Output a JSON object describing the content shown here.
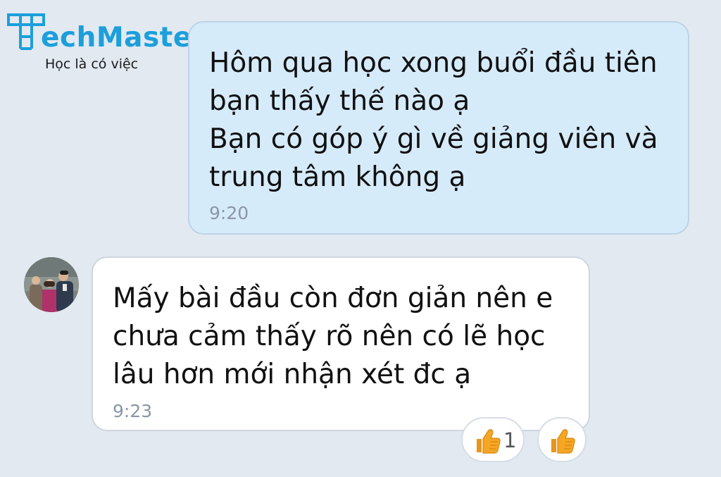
{
  "logo": {
    "wordmark": "TechMaster",
    "wordmark_rest": "echMaster",
    "tagline": "Học là có việc",
    "color": "#1c9fdb"
  },
  "messages": [
    {
      "direction": "outgoing",
      "text": "Hôm qua học xong buổi đầu tiên\nbạn thấy thế nào ạ\nBạn có góp ý gì về giảng viên và\ntrung tâm không ạ",
      "time": "9:20",
      "bg": "#d6ebfa"
    },
    {
      "direction": "incoming",
      "text": "Mấy bài đầu còn đơn giản nên e\nchưa cảm thấy rõ nên có lẽ học\nlâu hơn mới nhận xét đc ạ",
      "time": "9:23",
      "bg": "#ffffff",
      "avatar_icon": "user-photo-avatar"
    }
  ],
  "reactions": {
    "thumbs_up": {
      "icon": "thumbs-up-icon",
      "count": "1"
    },
    "add": {
      "icon": "thumbs-up-icon"
    }
  },
  "colors": {
    "background": "#e2e9f1",
    "timestamp": "#8a97a6",
    "thumb": "#f5a623"
  }
}
